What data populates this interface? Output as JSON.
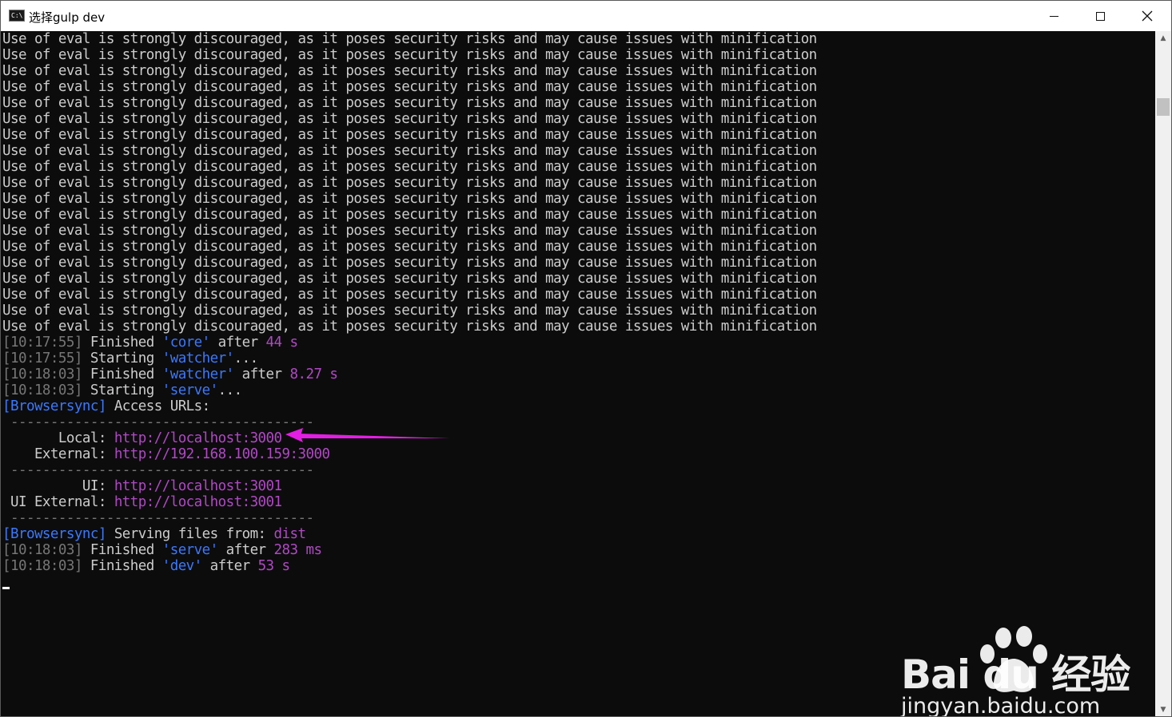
{
  "window": {
    "title": "选择gulp dev",
    "icon": "cmd-icon",
    "icon_text": "C:\\"
  },
  "console": {
    "warning_line": "Use of eval is strongly discouraged, as it poses security risks and may cause issues with minification",
    "warning_count": 19,
    "log": [
      {
        "time": "[10:17:55]",
        "verb": " Finished ",
        "task": "'core'",
        "after": " after ",
        "dur": "44 s",
        "tail": ""
      },
      {
        "time": "[10:17:55]",
        "verb": " Starting ",
        "task": "'watcher'",
        "after": "",
        "dur": "",
        "tail": "..."
      },
      {
        "time": "[10:18:03]",
        "verb": " Finished ",
        "task": "'watcher'",
        "after": " after ",
        "dur": "8.27 s",
        "tail": ""
      },
      {
        "time": "[10:18:03]",
        "verb": " Starting ",
        "task": "'serve'",
        "after": "",
        "dur": "",
        "tail": "..."
      }
    ],
    "bs_tag": "[Browsersync]",
    "bs_access": " Access URLs:",
    "rule": " --------------------------------------",
    "urls": {
      "local_label": "       Local: ",
      "local_url": "http://localhost:3000",
      "external_label": "    External: ",
      "external_url": "http://192.168.100.159:3000",
      "ui_label": "          UI: ",
      "ui_url": "http://localhost:3001",
      "ui_external_label": " UI External: ",
      "ui_external_url": "http://localhost:3001"
    },
    "bs_serving": " Serving files from: ",
    "bs_dir": "dist",
    "final": [
      {
        "time": "[10:18:03]",
        "verb": " Finished ",
        "task": "'serve'",
        "after": " after ",
        "dur": "283 ms"
      },
      {
        "time": "[10:18:03]",
        "verb": " Finished ",
        "task": "'dev'",
        "after": " after ",
        "dur": "53 s"
      }
    ]
  },
  "annotation": {
    "arrow_color": "#e31ee3"
  },
  "watermark": {
    "logo": "Bai du 经验",
    "url": "jingyan.baidu.com"
  },
  "colors": {
    "background": "#0c0c0c",
    "text": "#cccccc",
    "timestamp": "#767676",
    "task": "#3b78ff",
    "url": "#b148c6"
  }
}
